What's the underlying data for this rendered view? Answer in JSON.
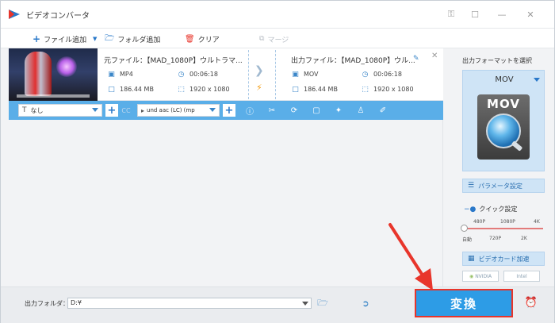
{
  "window": {
    "title": "ビデオコンバータ"
  },
  "toolbar": {
    "add_file": "ファイル追加",
    "add_folder": "フォルダ追加",
    "clear": "クリア",
    "merge": "マージ"
  },
  "file": {
    "source_label": "元ファイル：【MAD_1080P】ウルトラマ...",
    "source_format": "MP4",
    "source_duration": "00:06:18",
    "source_size": "186.44 MB",
    "source_resolution": "1920 x 1080",
    "output_label": "出力ファイル：【MAD_1080P】ウル...",
    "output_format": "MOV",
    "output_duration": "00:06:18",
    "output_size": "186.44 MB",
    "output_resolution": "1920 x 1080"
  },
  "editbar": {
    "subtitle_value": "なし",
    "audio_value": "und aac (LC) (mp",
    "cc_label": "CC"
  },
  "right_panel": {
    "select_format_label": "出力フォーマットを選択",
    "format": "MOV",
    "format_icon_text": "MOV",
    "param_button": "パラメータ設定",
    "quick_settings": "クイック設定",
    "quality_top": [
      "480P",
      "1080P",
      "4K"
    ],
    "quality_bottom": [
      "自動",
      "720P",
      "2K"
    ],
    "quality_level": 0,
    "gpu_button": "ビデオカード加速",
    "nvidia": "NVIDIA",
    "intel": "Intel"
  },
  "bottom": {
    "output_folder_label": "出力フォルダ：",
    "output_path": "D:¥",
    "convert_button": "変換"
  },
  "colors": {
    "accent": "#2d9ce6",
    "editbar": "#5aaee8",
    "highlight": "#e8352b"
  }
}
